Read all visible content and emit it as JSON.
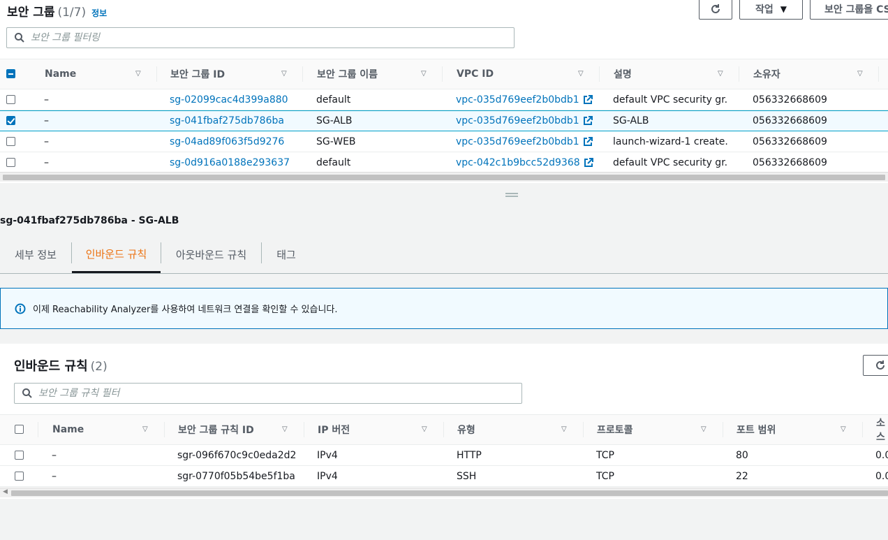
{
  "security_groups": {
    "title": "보안 그룹",
    "count": "(1/7)",
    "info": "정보",
    "actions_label": "작업",
    "create_label": "보안 그룹을 CS",
    "filter_placeholder": "보안 그룹 필터링",
    "columns": [
      "Name",
      "보안 그룹 ID",
      "보안 그룹 이름",
      "VPC ID",
      "설명",
      "소유자"
    ],
    "rows": [
      {
        "name": "–",
        "sg_id": "sg-02099cac4d399a880",
        "sg_name": "default",
        "vpc_id": "vpc-035d769eef2b0bdb1",
        "desc": "default VPC security gr...",
        "owner": "056332668609",
        "selected": false
      },
      {
        "name": "–",
        "sg_id": "sg-041fbaf275db786ba",
        "sg_name": "SG-ALB",
        "vpc_id": "vpc-035d769eef2b0bdb1",
        "desc": "SG-ALB",
        "owner": "056332668609",
        "selected": true
      },
      {
        "name": "–",
        "sg_id": "sg-04ad89f063f5d9276",
        "sg_name": "SG-WEB",
        "vpc_id": "vpc-035d769eef2b0bdb1",
        "desc": "launch-wizard-1 create...",
        "owner": "056332668609",
        "selected": false
      },
      {
        "name": "–",
        "sg_id": "sg-0d916a0188e293637",
        "sg_name": "default",
        "vpc_id": "vpc-042c1b9bcc52d9368",
        "desc": "default VPC security gr...",
        "owner": "056332668609",
        "selected": false
      }
    ]
  },
  "detail": {
    "title": "sg-041fbaf275db786ba - SG-ALB",
    "tabs": [
      "세부 정보",
      "인바운드 규칙",
      "아웃바운드 규칙",
      "태그"
    ],
    "active_tab": 1
  },
  "alert": {
    "text": "이제 Reachability Analyzer를 사용하여 네트워크 연결을 확인할 수 있습니다."
  },
  "inbound": {
    "title": "인바운드 규칙",
    "count": "(2)",
    "filter_placeholder": "보안 그룹 규칙 필터",
    "columns": [
      "Name",
      "보안 그룹 규칙 ID",
      "IP 버전",
      "유형",
      "프로토콜",
      "포트 범위",
      "소스"
    ],
    "rows": [
      {
        "name": "–",
        "rule_id": "sgr-096f670c9c0eda2d2",
        "ip": "IPv4",
        "type": "HTTP",
        "protocol": "TCP",
        "port": "80",
        "source": "0.0"
      },
      {
        "name": "–",
        "rule_id": "sgr-0770f05b54be5f1ba",
        "ip": "IPv4",
        "type": "SSH",
        "protocol": "TCP",
        "port": "22",
        "source": "0.0"
      }
    ]
  },
  "colors": {
    "link": "#0073bb",
    "active_tab": "#ec7211",
    "selected_row": "#f1faff"
  }
}
